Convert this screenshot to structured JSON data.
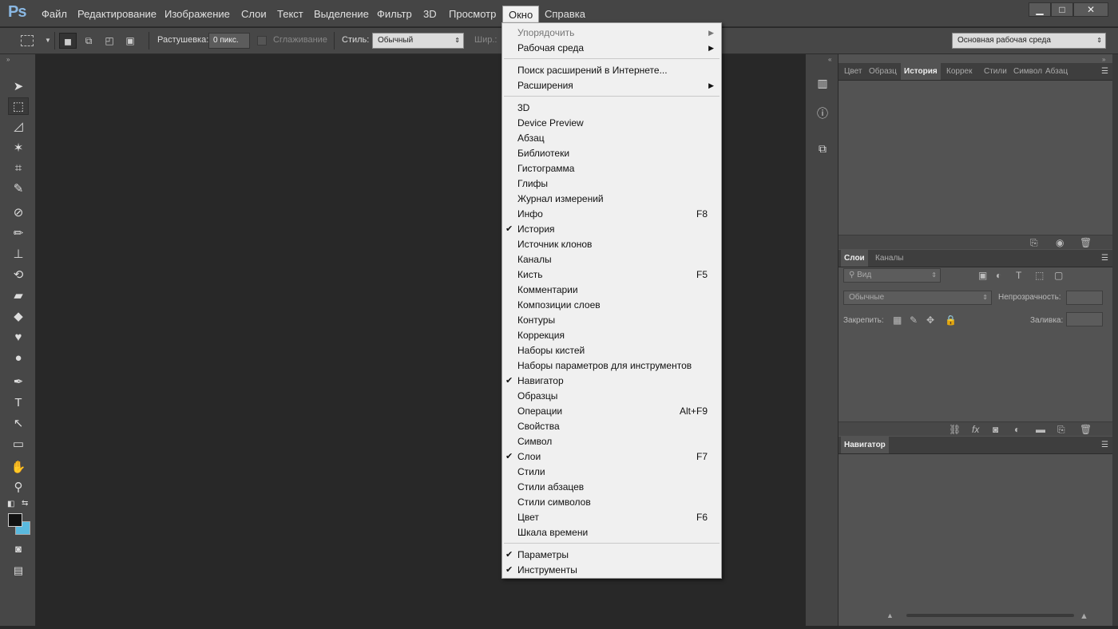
{
  "app": {
    "logo": "Ps"
  },
  "menubar": {
    "items": [
      "Файл",
      "Редактирование",
      "Изображение",
      "Слои",
      "Текст",
      "Выделение",
      "Фильтр",
      "3D",
      "Просмотр",
      "Окно",
      "Справка"
    ],
    "active": "Окно"
  },
  "window_controls": {
    "minimize": "▁",
    "maximize": "□",
    "close": "✕"
  },
  "options": {
    "feather_label": "Растушевка:",
    "feather_value": "0 пикс.",
    "antialias_label": "Сглаживание",
    "style_label": "Стиль:",
    "style_value": "Обычный",
    "width_label": "Шир.:",
    "workspace_value": "Основная рабочая среда"
  },
  "window_menu": {
    "groups": [
      [
        {
          "label": "Упорядочить",
          "submenu": true,
          "disabled": true
        },
        {
          "label": "Рабочая среда",
          "submenu": true
        }
      ],
      [
        {
          "label": "Поиск расширений в Интернете..."
        },
        {
          "label": "Расширения",
          "submenu": true
        }
      ],
      [
        {
          "label": "3D"
        },
        {
          "label": "Device Preview"
        },
        {
          "label": "Абзац"
        },
        {
          "label": "Библиотеки"
        },
        {
          "label": "Гистограмма"
        },
        {
          "label": "Глифы"
        },
        {
          "label": "Журнал измерений"
        },
        {
          "label": "Инфо",
          "shortcut": "F8"
        },
        {
          "label": "История",
          "checked": true
        },
        {
          "label": "Источник клонов"
        },
        {
          "label": "Каналы"
        },
        {
          "label": "Кисть",
          "shortcut": "F5"
        },
        {
          "label": "Комментарии"
        },
        {
          "label": "Композиции слоев"
        },
        {
          "label": "Контуры"
        },
        {
          "label": "Коррекция"
        },
        {
          "label": "Наборы кистей"
        },
        {
          "label": "Наборы параметров для инструментов"
        },
        {
          "label": "Навигатор",
          "checked": true
        },
        {
          "label": "Образцы"
        },
        {
          "label": "Операции",
          "shortcut": "Alt+F9"
        },
        {
          "label": "Свойства"
        },
        {
          "label": "Символ"
        },
        {
          "label": "Слои",
          "checked": true,
          "shortcut": "F7"
        },
        {
          "label": "Стили"
        },
        {
          "label": "Стили абзацев"
        },
        {
          "label": "Стили символов"
        },
        {
          "label": "Цвет",
          "shortcut": "F6"
        },
        {
          "label": "Шкала времени"
        }
      ],
      [
        {
          "label": "Параметры",
          "checked": true
        },
        {
          "label": "Инструменты",
          "checked": true
        }
      ]
    ]
  },
  "panels": {
    "top_tabs": [
      "Цвет",
      "Образц",
      "История",
      "Коррек",
      "Стили",
      "Символ",
      "Абзац"
    ],
    "top_active": "История",
    "layers_tabs": [
      "Слои",
      "Каналы"
    ],
    "layers_active": "Слои",
    "layers_filter": "Вид",
    "blend_mode": "Обычные",
    "opacity_label": "Непрозрачность:",
    "lock_label": "Закрепить:",
    "fill_label": "Заливка:",
    "navigator_tab": "Навигатор"
  }
}
